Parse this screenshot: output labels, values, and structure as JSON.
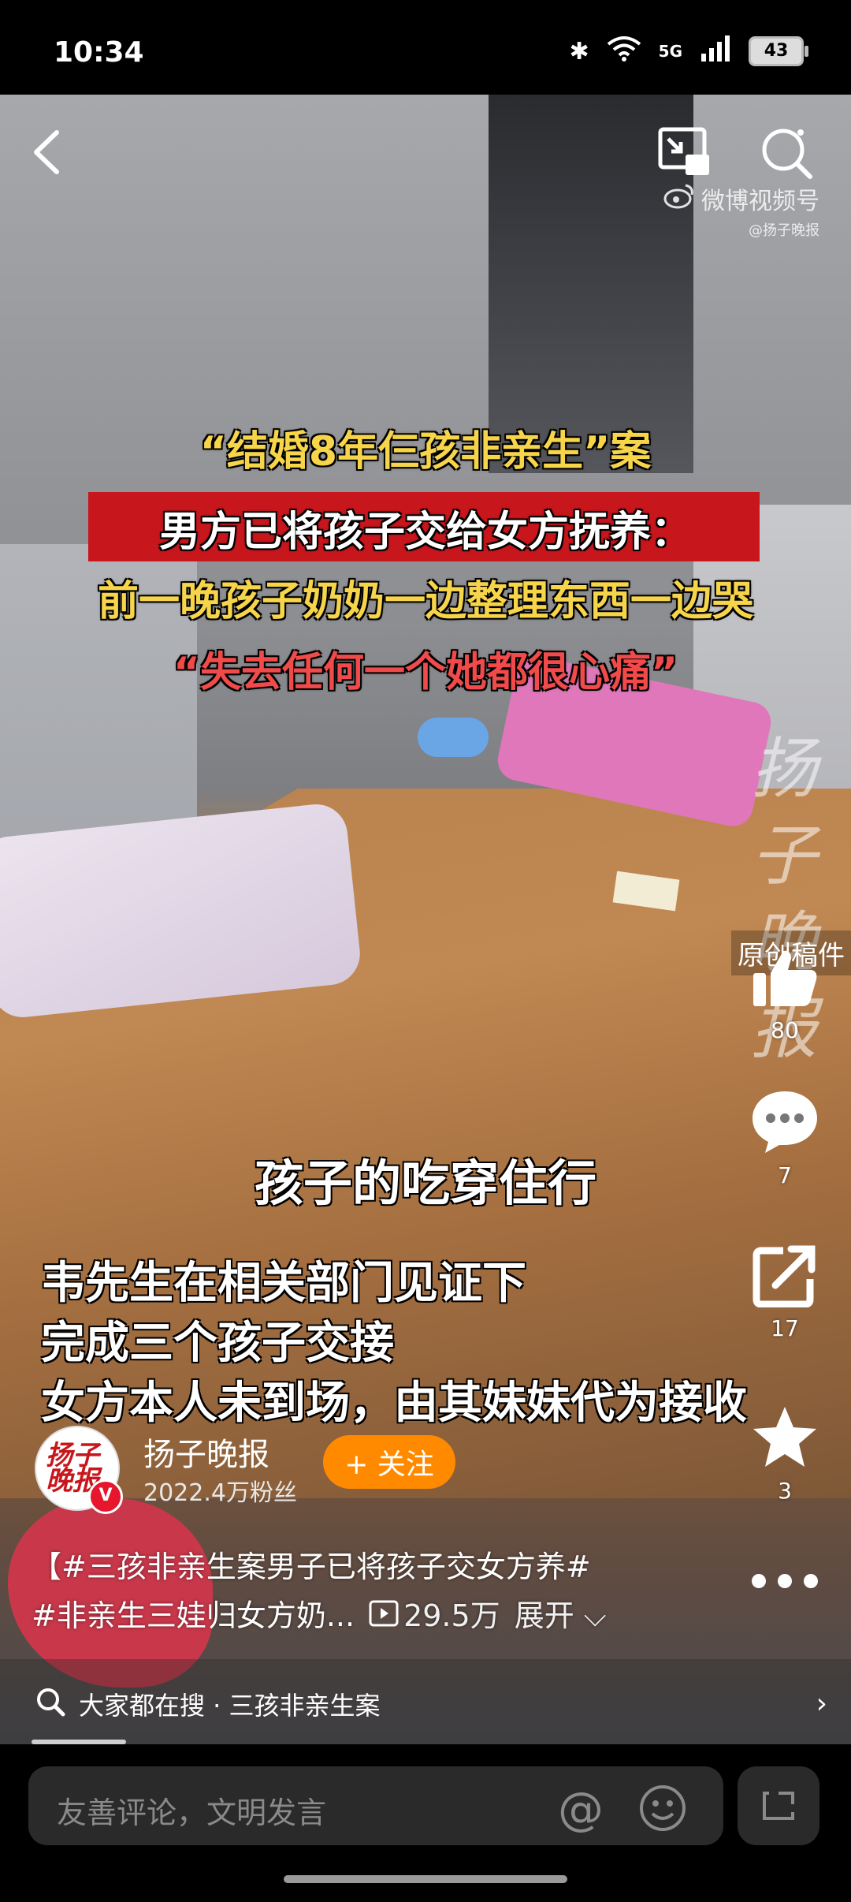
{
  "status": {
    "time": "10:34",
    "network": "5G",
    "battery": "43"
  },
  "video": {
    "headline": [
      "“结婚8年仨孩非亲生”案",
      "男方已将孩子交给女方抚养：",
      "前一晚孩子奶奶一边整理东西一边哭",
      "“失去任何一个她都很心痛”"
    ],
    "watermark_brand": "微博视频号",
    "watermark_user": "@扬子晚报",
    "side_watermark": "扬子晚报",
    "original_tag": "原创稿件",
    "subtitle_center": "孩子的吃穿住行",
    "subtitle_lines": [
      "韦先生在相关部门见证下",
      "完成三个孩子交接",
      "女方本人未到场，由其妹妹代为接收"
    ]
  },
  "actions": {
    "likes": "80",
    "comments": "7",
    "shares": "17",
    "favorites": "3"
  },
  "author": {
    "name": "扬子晚报",
    "fans": "2022.4万粉丝",
    "follow_label": "+ 关注",
    "avatar_text": "扬子晚报"
  },
  "description": {
    "line1": "【#三孩非亲生案男子已将孩子交女方养#",
    "line2": "#非亲生三娃归女方奶...",
    "views": "29.5万",
    "expand": "展开"
  },
  "search": {
    "text": "大家都在搜 · 三孩非亲生案"
  },
  "comment": {
    "placeholder": "友善评论，文明发言"
  },
  "icons": [
    "back-icon",
    "pip-icon",
    "search-icon",
    "weibo-logo-icon",
    "like-icon",
    "comment-icon",
    "share-icon",
    "star-icon",
    "more-icon",
    "play-icon",
    "at-icon",
    "emoji-icon",
    "expand-icon"
  ]
}
